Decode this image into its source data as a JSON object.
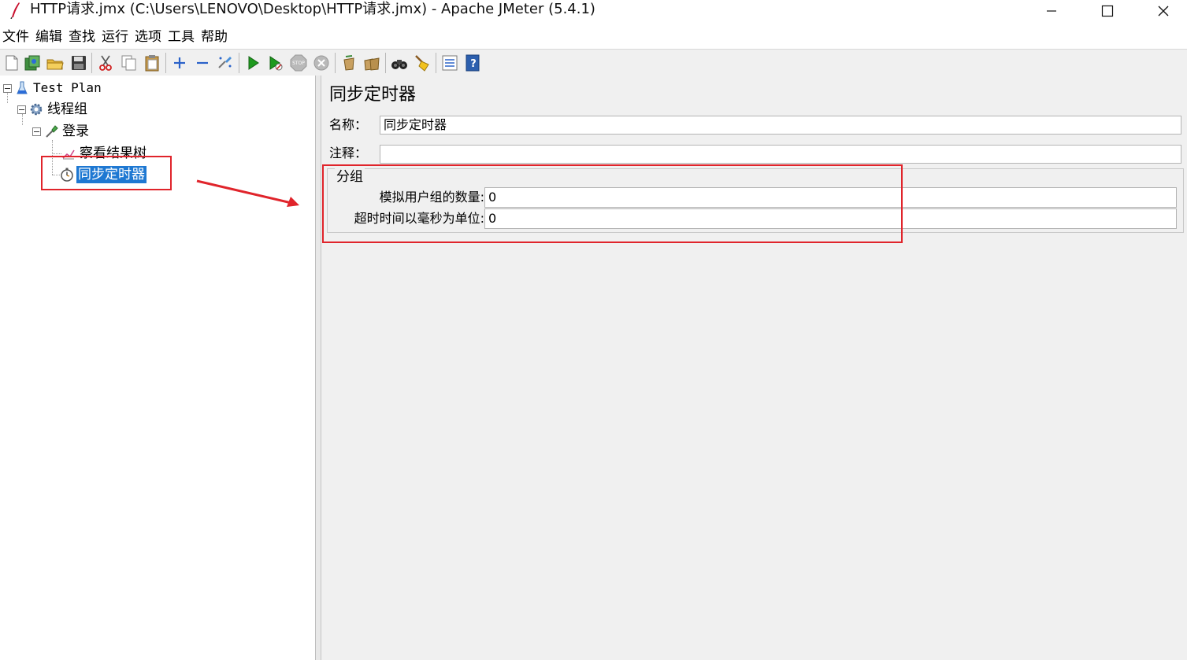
{
  "window": {
    "title": "HTTP请求.jmx (C:\\Users\\LENOVO\\Desktop\\HTTP请求.jmx) - Apache JMeter (5.4.1)"
  },
  "menu": [
    "文件",
    "编辑",
    "查找",
    "运行",
    "选项",
    "工具",
    "帮助"
  ],
  "toolbar": {
    "icons": [
      "new-icon",
      "templates-icon",
      "open-icon",
      "save-icon",
      "cut-icon",
      "copy-icon",
      "paste-icon",
      "expand-icon",
      "collapse-icon",
      "toggle-icon",
      "start-icon",
      "start-no-pauses-icon",
      "stop-icon",
      "shutdown-icon",
      "clear-icon",
      "clear-all-icon",
      "search-icon",
      "reset-search-icon",
      "function-helper-icon",
      "help-icon"
    ]
  },
  "tree": {
    "nodes": [
      {
        "label": "Test Plan",
        "icon": "test-plan-icon"
      },
      {
        "label": "线程组",
        "icon": "thread-group-gear-icon"
      },
      {
        "label": "登录",
        "icon": "http-sampler-pipette-icon"
      },
      {
        "label": "察看结果树",
        "icon": "listener-chart-icon"
      },
      {
        "label": "同步定时器",
        "icon": "timer-stopwatch-icon",
        "selected": true
      }
    ]
  },
  "panel": {
    "title": "同步定时器",
    "name_label": "名称：",
    "name_value": "同步定时器",
    "comment_label": "注释：",
    "comment_value": "",
    "group": {
      "title": "分组",
      "users_label": "模拟用户组的数量:",
      "users_value": "0",
      "timeout_label": "超时时间以毫秒为单位:",
      "timeout_value": "0"
    }
  },
  "colors": {
    "selection": "#1e78d2",
    "annotation": "#e0242b",
    "panel_bg": "#f0f0f0"
  }
}
